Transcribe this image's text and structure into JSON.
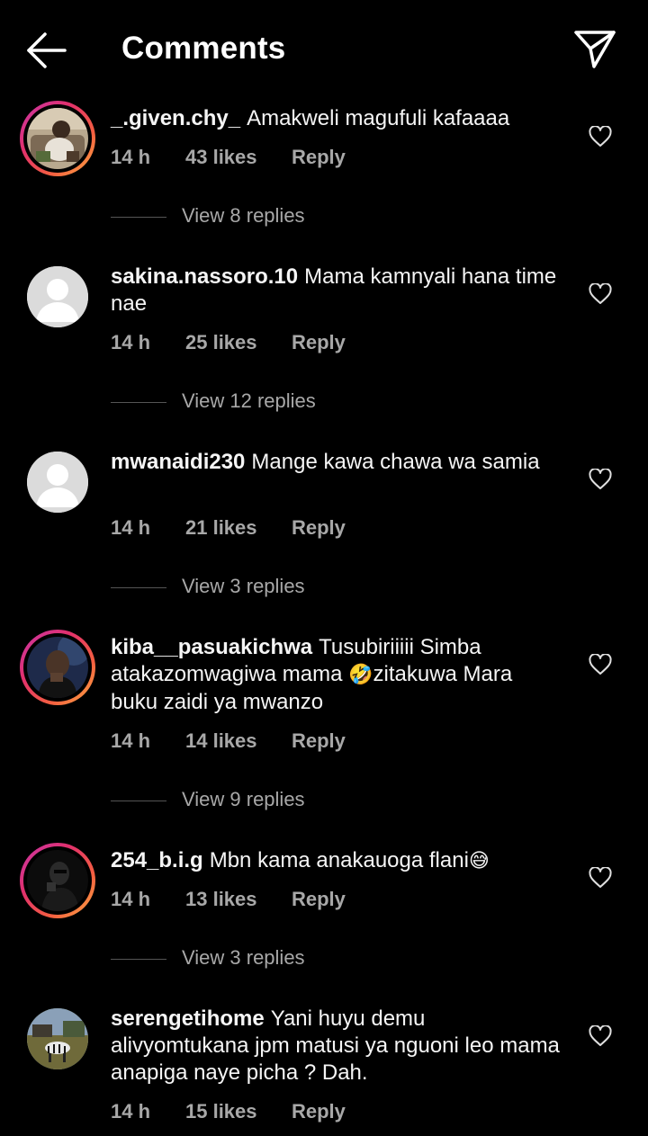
{
  "header": {
    "title": "Comments",
    "back_icon": "arrow-left-icon",
    "share_icon": "paper-plane-icon"
  },
  "comments": [
    {
      "username": "_.given.chy_",
      "text": "Amakweli magufuli kafaaaa",
      "time": "14 h",
      "likes": "43 likes",
      "reply": "Reply",
      "view_replies": "View 8 replies",
      "has_story_ring": true
    },
    {
      "username": "sakina.nassoro.10",
      "text": "Mama kamnyali hana time nae",
      "time": "14 h",
      "likes": "25 likes",
      "reply": "Reply",
      "view_replies": "View 12 replies",
      "has_story_ring": false
    },
    {
      "username": "mwanaidi230",
      "text": "Mange kawa chawa wa samia",
      "time": "14 h",
      "likes": "21 likes",
      "reply": "Reply",
      "view_replies": "View 3 replies",
      "has_story_ring": false
    },
    {
      "username": "kiba__pasuakichwa",
      "text_before_emoji": "Tusubiriiiii Simba atakazomwagiwa mama ",
      "emoji": "🤣",
      "text_after_emoji": "zitakuwa Mara buku zaidi ya mwanzo",
      "time": "14 h",
      "likes": "14 likes",
      "reply": "Reply",
      "view_replies": "View 9 replies",
      "has_story_ring": true
    },
    {
      "username": "254_b.i.g",
      "text": "Mbn kama anakauoga flani",
      "emoji": "😅",
      "time": "14 h",
      "likes": "13 likes",
      "reply": "Reply",
      "view_replies": "View 3 replies",
      "has_story_ring": true
    },
    {
      "username": "serengetihome",
      "text": "Yani huyu demu alivyomtukana jpm matusi ya nguoni leo mama anapiga naye picha ? Dah.",
      "time": "14 h",
      "likes": "15 likes",
      "reply": "Reply",
      "has_story_ring": false
    }
  ],
  "colors": {
    "background": "#000000",
    "text": "#f5f5f5",
    "secondary_text": "#a8a8a8",
    "ring_gradient": [
      "#c837ab",
      "#e1306c",
      "#f56040",
      "#fcaf45"
    ]
  }
}
